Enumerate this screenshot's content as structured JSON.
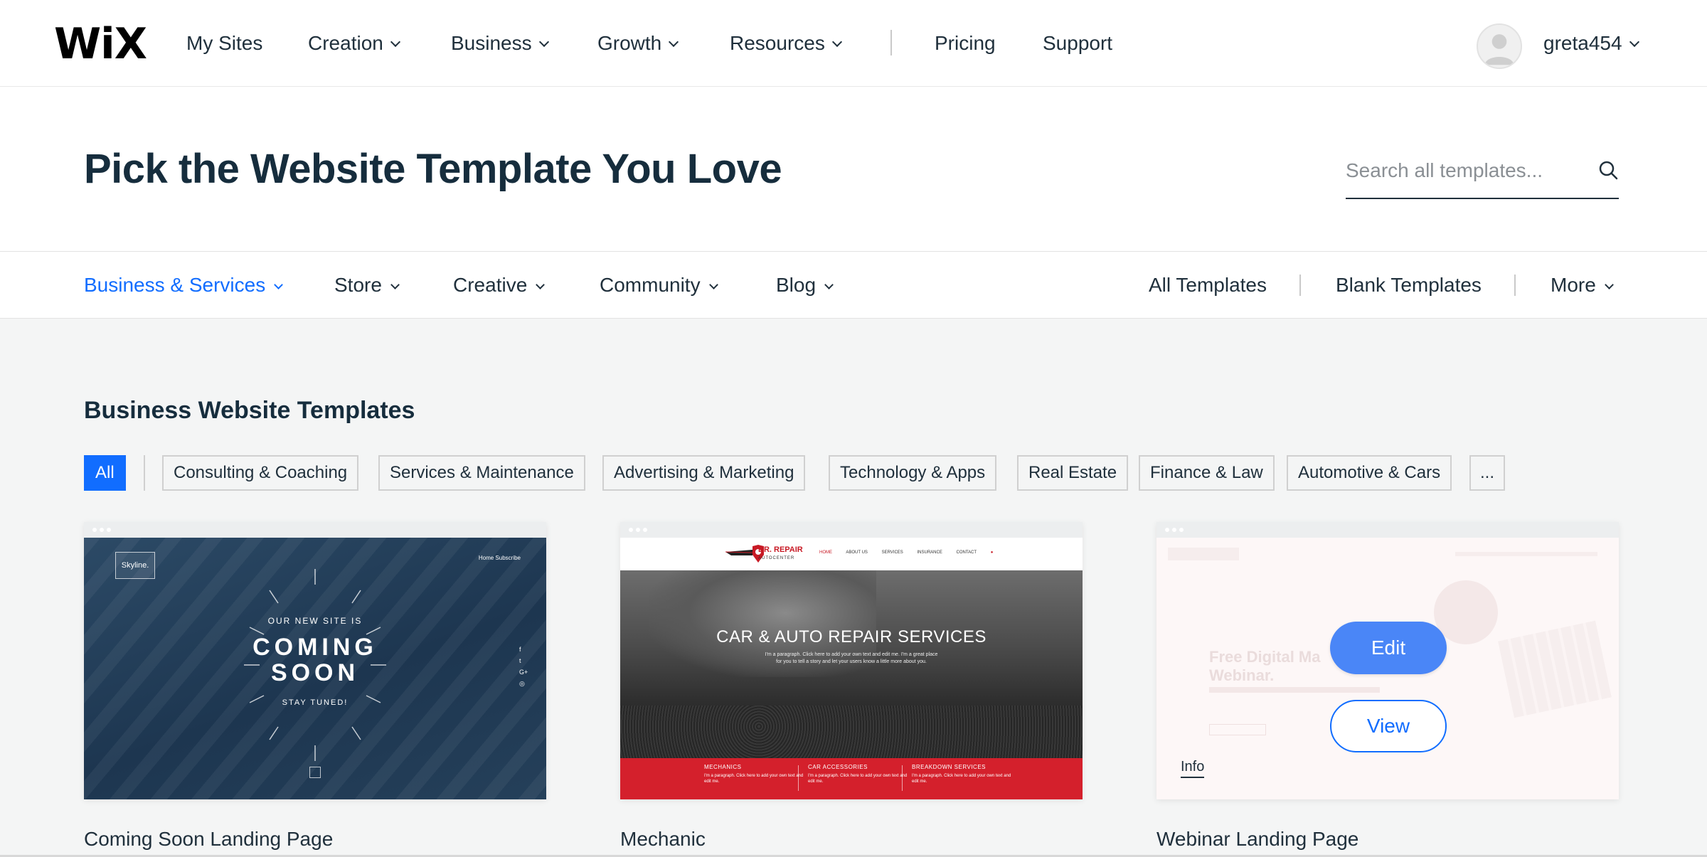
{
  "nav": {
    "logo": "WiX",
    "items": [
      "My Sites",
      "Creation",
      "Business",
      "Growth",
      "Resources",
      "Pricing",
      "Support"
    ],
    "username": "greta454"
  },
  "header": {
    "title": "Pick the Website Template You Love",
    "search_placeholder": "Search all templates..."
  },
  "categories": {
    "left": [
      "Business & Services",
      "Store",
      "Creative",
      "Community",
      "Blog"
    ],
    "right": [
      "All Templates",
      "Blank Templates",
      "More"
    ]
  },
  "section": {
    "title": "Business Website Templates",
    "chips": [
      "All",
      "Consulting & Coaching",
      "Services & Maintenance",
      "Advertising & Marketing",
      "Technology & Apps",
      "Real Estate",
      "Finance & Law",
      "Automotive & Cars",
      "..."
    ]
  },
  "cards": [
    {
      "name": "Coming Soon Landing Page",
      "preview": {
        "logo": "Skyline.",
        "nav": "Home   Subscribe",
        "line1": "OUR NEW SITE IS",
        "line2": "COMING",
        "line3": "SOON",
        "line4": "STAY TUNED!",
        "social": [
          "f",
          "t",
          "G+",
          "◎"
        ]
      }
    },
    {
      "name": "Mechanic",
      "preview": {
        "brand": "DR. REPAIR",
        "brand_sub": "AUTOCENTER",
        "nav": [
          "HOME",
          "ABOUT US",
          "SERVICES",
          "INSURANCE",
          "CONTACT"
        ],
        "hero_title": "CAR & AUTO REPAIR SERVICES",
        "hero_text": "I'm a paragraph. Click here to add your own text and edit me. I'm a great place for you to tell a story and let your users know a little more about you.",
        "columns": [
          {
            "title": "MECHANICS",
            "text": "I'm a paragraph. Click here to add your own text and edit me."
          },
          {
            "title": "CAR ACCESSORIES",
            "text": "I'm a paragraph. Click here to add your own text and edit me."
          },
          {
            "title": "BREAKDOWN SERVICES",
            "text": "I'm a paragraph. Click here to add your own text and edit me."
          }
        ]
      }
    },
    {
      "name": "Webinar Landing Page",
      "preview": {
        "faint_title_1": "Free Digital Ma",
        "faint_title_2": "Webinar."
      },
      "edit_label": "Edit",
      "view_label": "View",
      "info_label": "Info"
    }
  ],
  "colors": {
    "accent": "#116dff",
    "edit_button": "#4a86f7",
    "mechanic_red": "#d4202c",
    "page_bg": "#f4f5f5"
  }
}
